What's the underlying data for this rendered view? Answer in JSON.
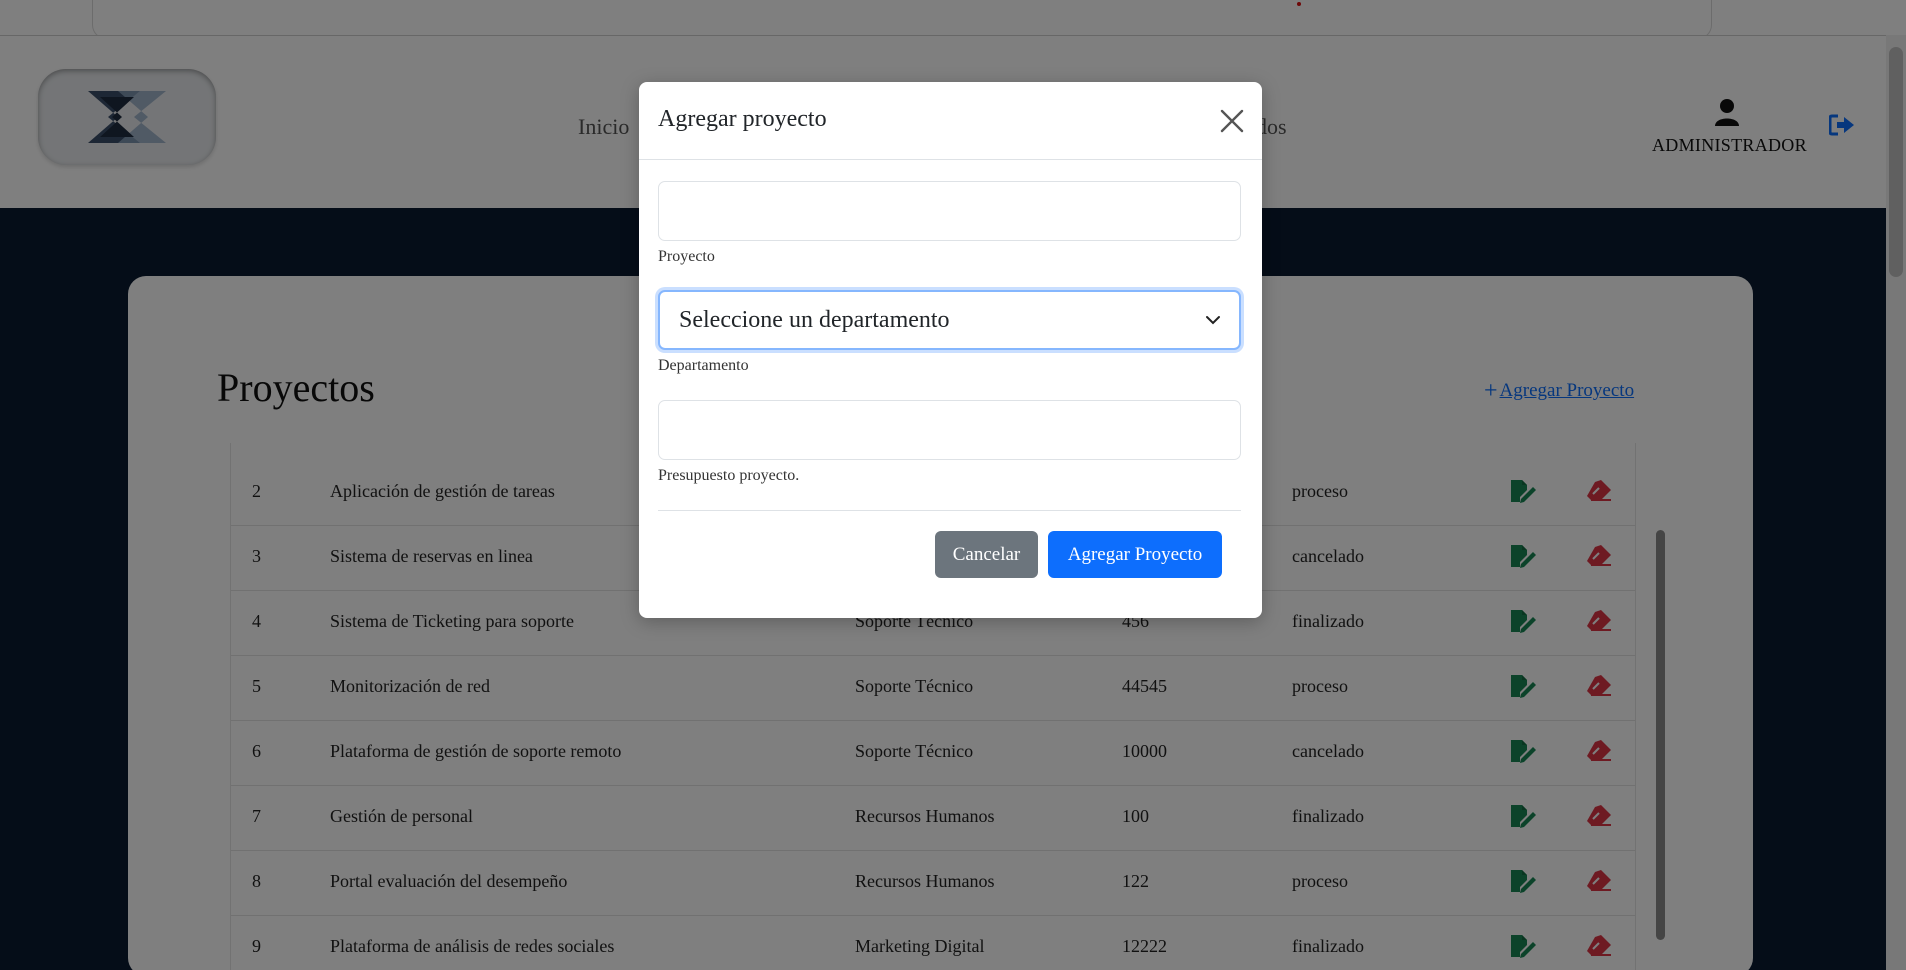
{
  "navbar": {
    "links": [
      "Inicio",
      "dos"
    ],
    "user_name": "ADMINISTRADOR"
  },
  "page": {
    "title": "Proyectos",
    "add_link": "Agregar Proyecto"
  },
  "table": {
    "rows": [
      {
        "id": "2",
        "name": "Aplicación de gestión de tareas",
        "department": "",
        "budget": "",
        "status": "proceso"
      },
      {
        "id": "3",
        "name": "Sistema de reservas en linea",
        "department": "",
        "budget": "",
        "status": "cancelado"
      },
      {
        "id": "4",
        "name": "Sistema de Ticketing para soporte",
        "department": "Soporte Técnico",
        "budget": "456",
        "status": "finalizado"
      },
      {
        "id": "5",
        "name": "Monitorización de red",
        "department": "Soporte Técnico",
        "budget": "44545",
        "status": "proceso"
      },
      {
        "id": "6",
        "name": "Plataforma de gestión de soporte remoto",
        "department": "Soporte Técnico",
        "budget": "10000",
        "status": "cancelado"
      },
      {
        "id": "7",
        "name": "Gestión de personal",
        "department": "Recursos Humanos",
        "budget": "100",
        "status": "finalizado"
      },
      {
        "id": "8",
        "name": "Portal evaluación del desempeño",
        "department": "Recursos Humanos",
        "budget": "122",
        "status": "proceso"
      },
      {
        "id": "9",
        "name": "Plataforma de análisis de redes sociales",
        "department": "Marketing Digital",
        "budget": "12222",
        "status": "finalizado"
      }
    ]
  },
  "modal": {
    "title": "Agregar proyecto",
    "project_value": "",
    "project_label": "Proyecto",
    "department_selected": "Seleccione un departamento",
    "department_label": "Departamento",
    "budget_value": "",
    "budget_label": "Presupuesto proyecto.",
    "cancel_label": "Cancelar",
    "submit_label": "Agregar Proyecto"
  },
  "colors": {
    "primary": "#0d6efd",
    "secondary": "#6c757d",
    "edit_icon": "#198754",
    "delete_icon": "#dc3545",
    "dark_background": "#0b1a31"
  },
  "icons": {
    "user": "user-icon",
    "logout": "logout-icon",
    "edit": "edit-icon",
    "delete": "eraser-icon",
    "close": "close-icon",
    "chevron": "chevron-down-icon",
    "plus": "plus-icon"
  }
}
